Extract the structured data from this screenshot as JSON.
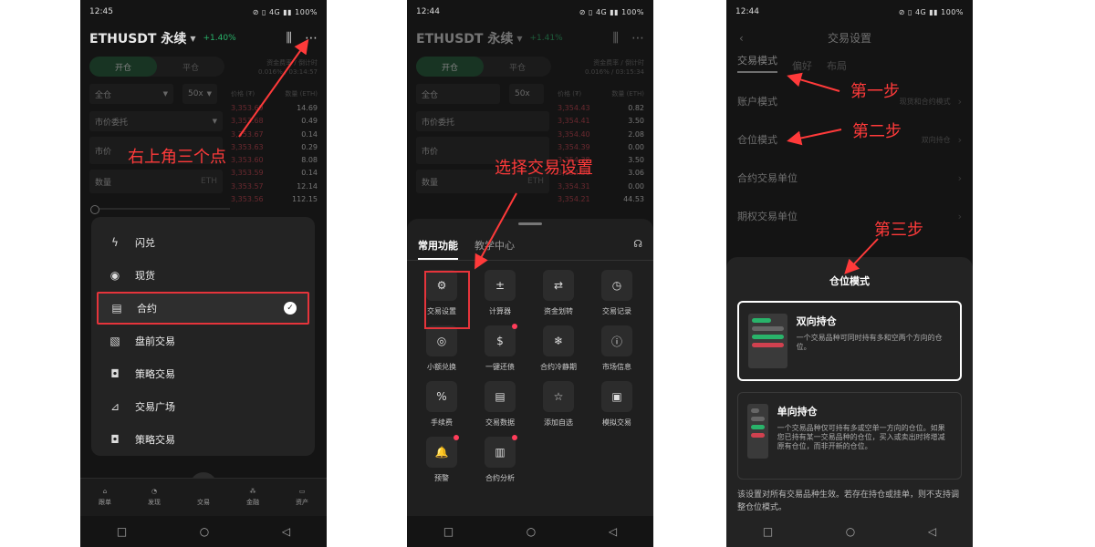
{
  "colors": {
    "red_annotation": "#ff3a3a",
    "green": "#29b36a",
    "ask_red": "#d0414f"
  },
  "p1": {
    "status": {
      "time": "12:45",
      "right": "⊘ ▯ 4G ▮▮ 100%"
    },
    "symbol": "ETHUSDT 永续",
    "change": "+1.40%",
    "tabs": {
      "open": "开仓",
      "close": "平仓"
    },
    "funding": {
      "label": "资金费率 / 倒计时",
      "value": "0.016% / 03:14:57"
    },
    "margin_mode": "全仓",
    "leverage": "50x",
    "order_type": "市价委托",
    "price_placeholder": "市价",
    "qty_label": "数量",
    "qty_unit": "ETH",
    "book_headers": {
      "price": "价格 (₮)",
      "qty": "数量 (ETH)"
    },
    "book": [
      {
        "p": "3,353.69",
        "q": "14.69"
      },
      {
        "p": "3,353.68",
        "q": "0.49"
      },
      {
        "p": "3,353.67",
        "q": "0.14"
      },
      {
        "p": "3,353.63",
        "q": "0.29"
      },
      {
        "p": "3,353.60",
        "q": "8.08"
      },
      {
        "p": "3,353.59",
        "q": "0.14"
      },
      {
        "p": "3,353.57",
        "q": "12.14"
      },
      {
        "p": "3,353.56",
        "q": "112.15"
      }
    ],
    "menu": [
      "闪兑",
      "现货",
      "合约",
      "盘前交易",
      "策略交易",
      "交易广场",
      "策略交易"
    ],
    "annotation": "右上角三个点",
    "bottom_nav": [
      "跟单",
      "发现",
      "交易",
      "金融",
      "资产"
    ]
  },
  "p2": {
    "status": {
      "time": "12:44",
      "right": "⊘ ▯ 4G ▮▮ 100%"
    },
    "symbol": "ETHUSDT 永续",
    "change": "+1.41%",
    "funding": {
      "label": "资金费率 / 倒计时",
      "value": "0.016% / 03:15:34"
    },
    "book": [
      {
        "p": "3,354.43",
        "q": "0.82"
      },
      {
        "p": "3,354.41",
        "q": "3.50"
      },
      {
        "p": "3,354.40",
        "q": "2.08"
      },
      {
        "p": "3,354.39",
        "q": "0.00"
      },
      {
        "p": "3,354.38",
        "q": "3.50"
      },
      {
        "p": "3,354.36",
        "q": "3.06"
      },
      {
        "p": "3,354.31",
        "q": "0.00"
      },
      {
        "p": "3,354.21",
        "q": "44.53"
      }
    ],
    "sheet_tabs": [
      "常用功能",
      "教学中心"
    ],
    "tools": [
      {
        "label": "交易设置",
        "icon": "⚙"
      },
      {
        "label": "计算器",
        "icon": "±"
      },
      {
        "label": "资金划转",
        "icon": "⇄"
      },
      {
        "label": "交易记录",
        "icon": "◷"
      },
      {
        "label": "小额兑换",
        "icon": "◎"
      },
      {
        "label": "一键还债",
        "icon": "$"
      },
      {
        "label": "合约冷静期",
        "icon": "❄"
      },
      {
        "label": "市场信息",
        "icon": "ⓘ"
      },
      {
        "label": "手续费",
        "icon": "%"
      },
      {
        "label": "交易数据",
        "icon": "▤"
      },
      {
        "label": "添加自选",
        "icon": "☆"
      },
      {
        "label": "模拟交易",
        "icon": "▣"
      },
      {
        "label": "预警",
        "icon": "🔔"
      },
      {
        "label": "合约分析",
        "icon": "▥"
      }
    ],
    "annotation": "选择交易设置"
  },
  "p3": {
    "status": {
      "time": "12:44",
      "right": "⊘ ▯ 4G ▮▮ 100%"
    },
    "title": "交易设置",
    "tabs": [
      "交易模式",
      "偏好",
      "布局"
    ],
    "rows": [
      {
        "label": "账户模式",
        "value": "现货和合约模式"
      },
      {
        "label": "仓位模式",
        "value": "双向持仓"
      },
      {
        "label": "合约交易单位",
        "value": ""
      },
      {
        "label": "期权交易单位",
        "value": ""
      }
    ],
    "annotations": [
      "第一步",
      "第二步",
      "第三步"
    ],
    "sheet_title": "仓位模式",
    "options": [
      {
        "title": "双向持仓",
        "desc": "一个交易品种可同时持有多和空两个方向的仓位。"
      },
      {
        "title": "单向持仓",
        "desc": "一个交易品种仅可持有多或空单一方向的仓位。如果您已持有某一交易品种的仓位，买入或卖出时将增减原有仓位，而非开新的仓位。"
      }
    ],
    "note": "该设置对所有交易品种生效。若存在持仓或挂单，则不支持调整仓位模式。"
  },
  "sys_nav": [
    "□",
    "○",
    "◁"
  ]
}
